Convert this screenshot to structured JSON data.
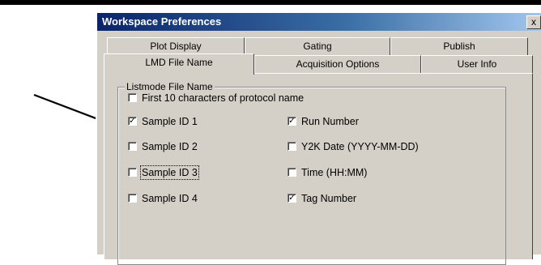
{
  "dialog": {
    "title": "Workspace Preferences",
    "close_glyph": "x"
  },
  "tabs": {
    "back_row": [
      {
        "label": "Plot Display"
      },
      {
        "label": "Gating"
      },
      {
        "label": "Publish"
      }
    ],
    "front_row": [
      {
        "label": "LMD File Name",
        "active": true
      },
      {
        "label": "Acquisition Options"
      },
      {
        "label": "User Info"
      }
    ]
  },
  "group": {
    "label": "Listmode File Name",
    "options": [
      {
        "label": "First 10 characters of protocol name",
        "checked": false,
        "mark": ""
      },
      {
        "label": "Sample ID 1",
        "checked": true,
        "mark": "✓"
      },
      {
        "label": "Run Number",
        "checked": true,
        "mark": "✓"
      },
      {
        "label": "Sample ID 2",
        "checked": false,
        "mark": ""
      },
      {
        "label": "Y2K Date (YYYY-MM-DD)",
        "checked": false,
        "mark": ""
      },
      {
        "label": "Sample ID 3",
        "checked": false,
        "mark": "",
        "focused": true
      },
      {
        "label": "Time (HH:MM)",
        "checked": false,
        "mark": ""
      },
      {
        "label": "Sample ID 4",
        "checked": false,
        "mark": ""
      },
      {
        "label": "Tag Number",
        "checked": true,
        "mark": "✓"
      }
    ]
  },
  "annotation": {
    "icon": "arrow-icon",
    "color": "#000000"
  }
}
